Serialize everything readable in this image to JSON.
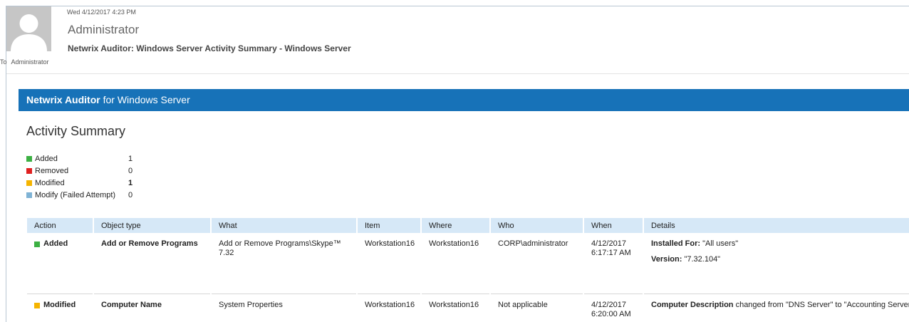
{
  "email": {
    "date": "Wed 4/12/2017 4:23 PM",
    "sender": "Administrator",
    "subject": "Netwrix Auditor: Windows Server Activity Summary - Windows Server",
    "to_label": "To",
    "to_value": "Administrator"
  },
  "banner": {
    "brand": "Netwrix Auditor",
    "suffix": "for Windows Server",
    "color": "#1772b8"
  },
  "summary": {
    "title": "Activity Summary",
    "legend": [
      {
        "label": "Added",
        "count": "1",
        "color": "#3cb043"
      },
      {
        "label": "Removed",
        "count": "0",
        "color": "#e02020"
      },
      {
        "label": "Modified",
        "count": "1",
        "color": "#f5b400"
      },
      {
        "label": "Modify (Failed Attempt)",
        "count": "0",
        "color": "#7fb3d5"
      }
    ]
  },
  "table": {
    "columns": [
      "Action",
      "Object type",
      "What",
      "Item",
      "Where",
      "Who",
      "When",
      "Details"
    ],
    "rows": [
      {
        "action": "Added",
        "action_color": "#3cb043",
        "object_type": "Add or Remove Programs",
        "what": "Add or Remove Programs\\Skype™ 7.32",
        "item": "Workstation16",
        "where": "Workstation16",
        "who": "CORP\\administrator",
        "when": "4/12/2017 6:17:17 AM",
        "details": [
          {
            "key": "Installed For:",
            "value": " \"All users\""
          },
          {
            "key": "Version:",
            "value": " \"7.32.104\""
          }
        ]
      },
      {
        "action": "Modified",
        "action_color": "#f5b400",
        "object_type": "Computer Name",
        "what": "System Properties",
        "item": "Workstation16",
        "where": "Workstation16",
        "who": "Not applicable",
        "when": "4/12/2017 6:20:00 AM",
        "details": [
          {
            "key": "Computer Description",
            "value": " changed from \"DNS Server\" to \"Accounting Server\""
          }
        ]
      }
    ]
  }
}
